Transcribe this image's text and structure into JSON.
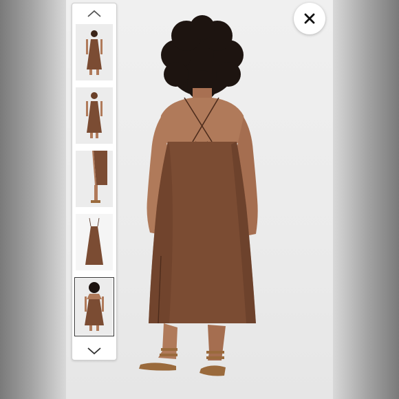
{
  "viewer": {
    "close_icon": "close-icon",
    "prev_icon": "chevron-up-icon",
    "next_icon": "chevron-down-icon",
    "main_image": "dress-back-view",
    "selected_thumbnail_index": 4
  },
  "thumbnails": [
    {
      "view": "front-full"
    },
    {
      "view": "back-full"
    },
    {
      "view": "side-slit-closeup"
    },
    {
      "view": "flat-lay-dress"
    },
    {
      "view": "back-model"
    }
  ],
  "colors": {
    "dress": "#7b4c33",
    "dress_shadow": "#5f3826",
    "skin": "#b07a5a",
    "skin_shadow": "#8f5c40",
    "hair": "#1d1410",
    "sandal": "#9a6a3c",
    "background": "#ececec"
  }
}
